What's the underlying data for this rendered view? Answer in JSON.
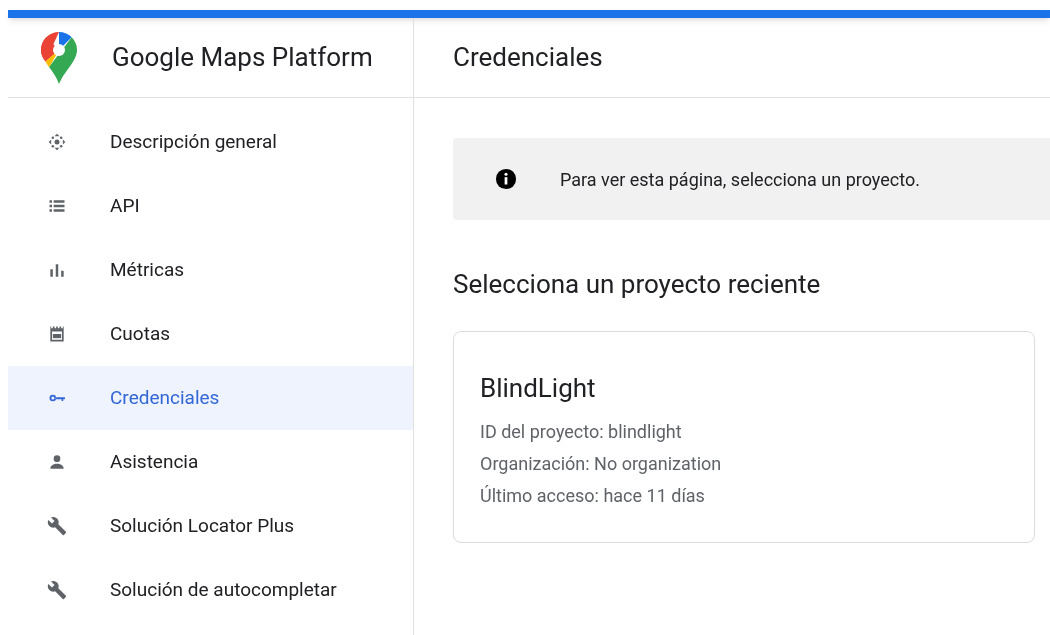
{
  "sidebar": {
    "title": "Google Maps Platform",
    "items": [
      {
        "label": "Descripción general",
        "kind": "overview",
        "selected": false
      },
      {
        "label": "API",
        "kind": "list",
        "selected": false
      },
      {
        "label": "Métricas",
        "kind": "metrics",
        "selected": false
      },
      {
        "label": "Cuotas",
        "kind": "quota",
        "selected": false
      },
      {
        "label": "Credenciales",
        "kind": "key",
        "selected": true
      },
      {
        "label": "Asistencia",
        "kind": "person",
        "selected": false
      },
      {
        "label": "Solución Locator Plus",
        "kind": "wrench",
        "selected": false
      },
      {
        "label": "Solución de autocompletar",
        "kind": "wrench",
        "selected": false
      }
    ]
  },
  "page": {
    "title": "Credenciales",
    "notice": "Para ver esta página, selecciona un proyecto.",
    "section_title": "Selecciona un proyecto reciente",
    "project": {
      "name": "BlindLight",
      "details": [
        "ID del proyecto: blindlight",
        "Organización: No organization",
        "Último acceso: hace 11 días"
      ]
    }
  }
}
